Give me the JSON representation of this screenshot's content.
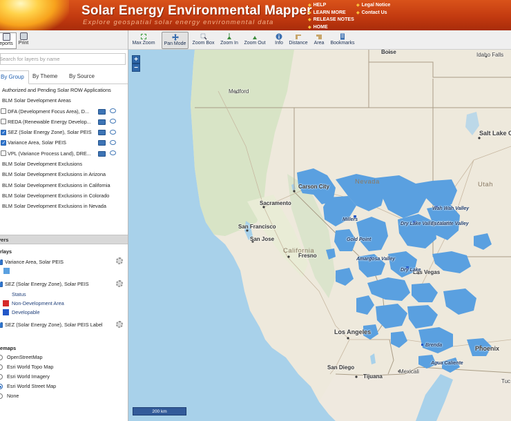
{
  "header": {
    "title": "Solar Energy Environmental Mapper",
    "subtitle": "Explore geospatial solar energy environmental data",
    "links_left": [
      "HELP",
      "LEARN MORE",
      "RELEASE NOTES",
      "HOME"
    ],
    "links_right": [
      "Legal Notice",
      "Contact Us"
    ]
  },
  "left_toolbar": {
    "reports": "eports",
    "print": "Print"
  },
  "search": {
    "placeholder": "Search for layers by name"
  },
  "tabs": [
    "By Group",
    "By Theme",
    "By Source"
  ],
  "layer_list": [
    {
      "label": "Authorized and Pending Solar ROW Applications",
      "kind": "group"
    },
    {
      "label": "BLM Solar Development Areas",
      "kind": "group"
    },
    {
      "label": "DFA (Development Focus Area), D...",
      "kind": "layer",
      "checked": false
    },
    {
      "label": "REDA (Renewable Energy Develop...",
      "kind": "layer",
      "checked": false
    },
    {
      "label": "SEZ (Solar Energy Zone), Solar PEIS",
      "kind": "layer",
      "checked": true
    },
    {
      "label": "Variance Area, Solar PEIS",
      "kind": "layer",
      "checked": true
    },
    {
      "label": "VPL (Variance Process Land), DRE...",
      "kind": "layer",
      "checked": false
    },
    {
      "label": "BLM Solar Development Exclusions",
      "kind": "group"
    },
    {
      "label": "BLM Solar Development Exclusions in Arizona",
      "kind": "group"
    },
    {
      "label": "BLM Solar Development Exclusions in California",
      "kind": "group"
    },
    {
      "label": "BLM Solar Development Exclusions in Colorado",
      "kind": "group"
    },
    {
      "label": "BLM Solar Development Exclusions in Nevada",
      "kind": "group"
    }
  ],
  "layers_bar": "yers",
  "legend": {
    "overlays_title": "erlays",
    "variance": "Variance Area, Solar PEIS",
    "sez": "SEZ (Solar Energy Zone), Solar PEIS",
    "status_title": "Status",
    "non_dev": "Non-Development Area",
    "developable": "Developable",
    "sez_label": "SEZ (Solar Energy Zone), Solar PEIS Label",
    "basemaps_title": "semaps",
    "basemaps": [
      "OpenStreetMap",
      "Esri World Topo Map",
      "Esri World Imagery",
      "Esri World Street Map",
      "None"
    ],
    "basemap_selected": "Esri World Street Map",
    "colors": {
      "variance": "#5aa0e0",
      "non_dev": "#d62a2a",
      "developable": "#2357c8"
    }
  },
  "toolbar": [
    "Max Zoom",
    "Pan Mode",
    "Zoom Box",
    "Zoom In",
    "Zoom Out",
    "Info",
    "Distance",
    "Area",
    "Bookmarks"
  ],
  "toolbar_active": "Pan Mode",
  "map": {
    "zoom_in": "+",
    "zoom_out": "−",
    "scale": "200 km",
    "cities": {
      "boise": "Boise",
      "idaho_falls": "Idaho Falls",
      "medford": "Medford",
      "salt_lake": "Salt Lake City",
      "utah_lbl": "Utah",
      "nevada_lbl": "Nevada",
      "carson": "Carson City",
      "sacramento": "Sacramento",
      "sf": "San Francisco",
      "san_jose": "San Jose",
      "california_lbl": "California",
      "fresno": "Fresno",
      "las_vegas": "Las Vegas",
      "la": "Los Angeles",
      "san_diego": "San Diego",
      "tijuana": "Tijuana",
      "mexicali": "Mexicali",
      "phoenix": "Phoenix",
      "tucson": "Tuc"
    },
    "zones": {
      "millers": "Millers",
      "gold_point": "Gold Point",
      "amargosa": "Amargosa Valley",
      "dry_lake_valley": "Dry Lake Valley North",
      "wah_wah": "Wah Wah Valley",
      "escalante": "Escalante Valley",
      "dry_lake": "Dry Lake",
      "brenda": "Brenda",
      "agua": "Agua Caliente"
    }
  }
}
